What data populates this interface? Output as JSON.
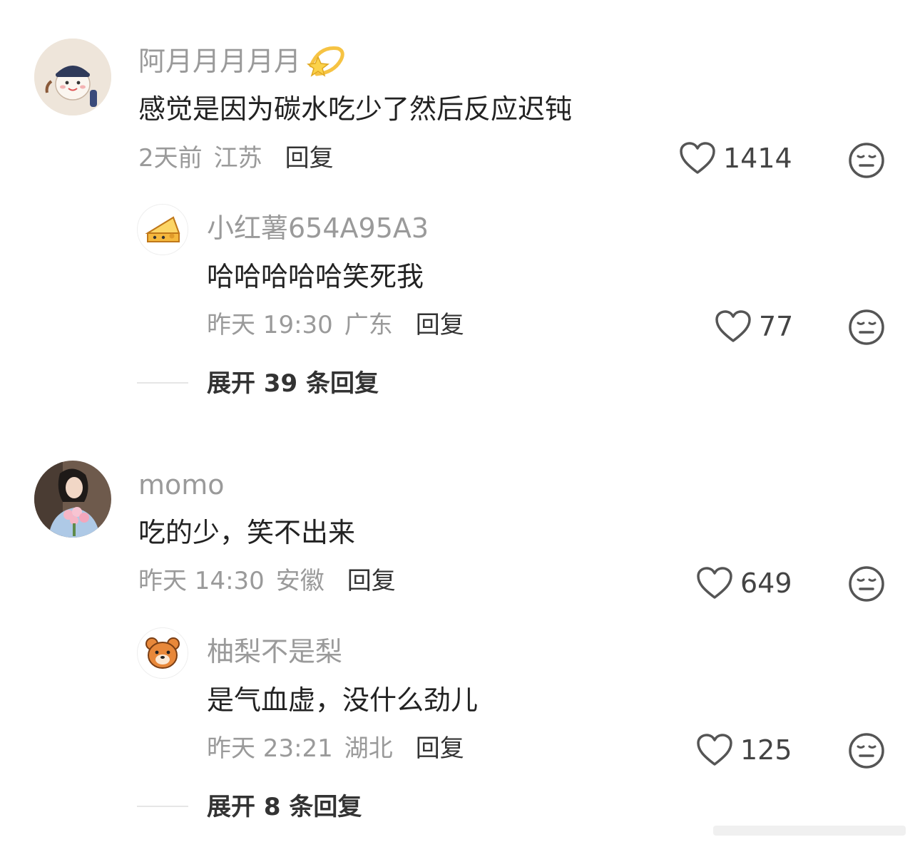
{
  "comments": [
    {
      "user": "阿月月月月月",
      "text": "感觉是因为碳水吃少了然后反应迟钝",
      "time": "2天前",
      "location": "江苏",
      "reply_label": "回复",
      "likes": "1414",
      "replies": [
        {
          "user": "小红薯654A95A3",
          "text": "哈哈哈哈哈笑死我",
          "time": "昨天 19:30",
          "location": "广东",
          "reply_label": "回复",
          "likes": "77"
        }
      ],
      "expand_label": "展开 39 条回复"
    },
    {
      "user": "momo",
      "text": "吃的少，笑不出来",
      "time": "昨天 14:30",
      "location": "安徽",
      "reply_label": "回复",
      "likes": "649",
      "replies": [
        {
          "user": "柚梨不是梨",
          "text": "是气血虚，没什么劲儿",
          "time": "昨天 23:21",
          "location": "湖北",
          "reply_label": "回复",
          "likes": "125"
        }
      ],
      "expand_label": "展开 8 条回复"
    }
  ],
  "icons": {
    "like": "heart-outline-icon",
    "dislike": "meh-face-icon",
    "name_badge": "dizzy-star-emoji"
  },
  "colors": {
    "username": "#9a9a9a",
    "text": "#222222",
    "meta": "#9a9a9a",
    "icon": "#555555",
    "cheese": "#f5b83d",
    "bear": "#e8883a"
  }
}
